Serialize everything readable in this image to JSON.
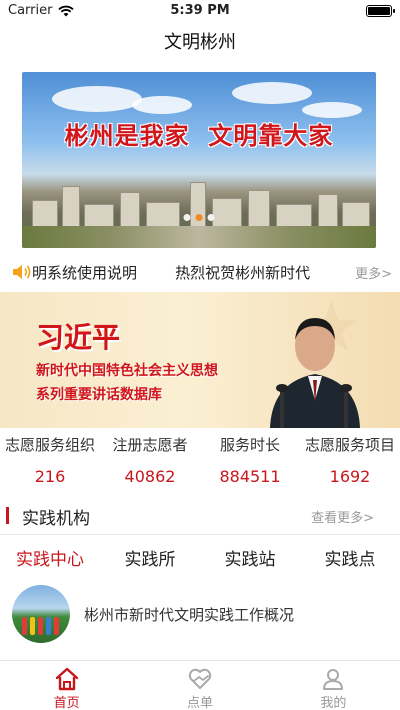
{
  "status_bar": {
    "carrier": "Carrier",
    "time": "5:39 PM",
    "icons": [
      "wifi-icon",
      "battery-icon"
    ]
  },
  "nav": {
    "title": "文明彬州"
  },
  "banner": {
    "slogan": "彬州是我家  文明靠大家",
    "page_count": 3,
    "active_page": 2
  },
  "notice": {
    "icon": "speaker-icon",
    "text": "明系统使用说明        热烈祝贺彬州新时代",
    "more": "更多>"
  },
  "promo": {
    "name": "习近平",
    "line1": "新时代中国特色社会主义思想",
    "line2": "系列重要讲话数据库"
  },
  "stats": [
    {
      "label": "志愿服务组织",
      "value": "216"
    },
    {
      "label": "注册志愿者",
      "value": "40862"
    },
    {
      "label": "服务时长",
      "value": "884511"
    },
    {
      "label": "志愿服务项目",
      "value": "1692"
    }
  ],
  "section": {
    "title": "实践机构",
    "more": "查看更多>"
  },
  "tabs": [
    {
      "label": "实践中心",
      "active": true
    },
    {
      "label": "实践所",
      "active": false
    },
    {
      "label": "实践站",
      "active": false
    },
    {
      "label": "实践点",
      "active": false
    }
  ],
  "list": [
    {
      "title": "彬州市新时代文明实践工作概况"
    }
  ],
  "tabbar": [
    {
      "label": "首页",
      "icon": "home-icon",
      "active": true
    },
    {
      "label": "点单",
      "icon": "heart-hands-icon",
      "active": false
    },
    {
      "label": "我的",
      "icon": "person-icon",
      "active": false
    }
  ],
  "colors": {
    "accent": "#c8161d",
    "muted": "#999999",
    "dot_active": "#f08a25"
  }
}
